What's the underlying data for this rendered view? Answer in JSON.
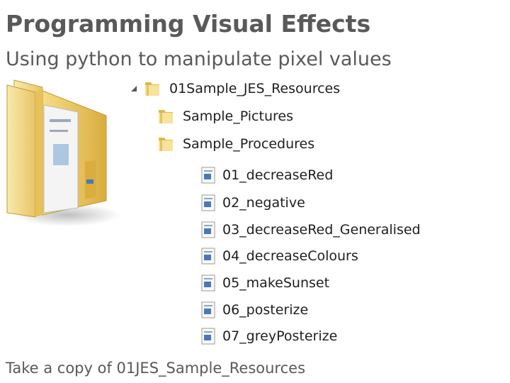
{
  "slide": {
    "title": "Programming Visual Effects",
    "subtitle": "Using python to manipulate pixel values",
    "footer": "Take a copy of 01JES_Sample_Resources"
  },
  "tree": {
    "root": {
      "label": "01Sample_JES_Resources",
      "icon": "folder-icon",
      "expanded": true
    },
    "folders": [
      {
        "label": "Sample_Pictures",
        "icon": "folder-icon"
      },
      {
        "label": "Sample_Procedures",
        "icon": "folder-icon",
        "expanded": true
      }
    ],
    "files": [
      {
        "label": "01_decreaseRed",
        "icon": "python-file-icon"
      },
      {
        "label": "02_negative",
        "icon": "python-file-icon"
      },
      {
        "label": "03_decreaseRed_Generalised",
        "icon": "python-file-icon"
      },
      {
        "label": "04_decreaseColours",
        "icon": "python-file-icon"
      },
      {
        "label": "05_makeSunset",
        "icon": "python-file-icon"
      },
      {
        "label": "06_posterize",
        "icon": "python-file-icon"
      },
      {
        "label": "07_greyPosterize",
        "icon": "python-file-icon"
      }
    ]
  },
  "colors": {
    "text": "#595959",
    "folder_light": "#f7e39a",
    "folder_dark": "#e3b94a",
    "file_icon_blue": "#4a78b8"
  }
}
